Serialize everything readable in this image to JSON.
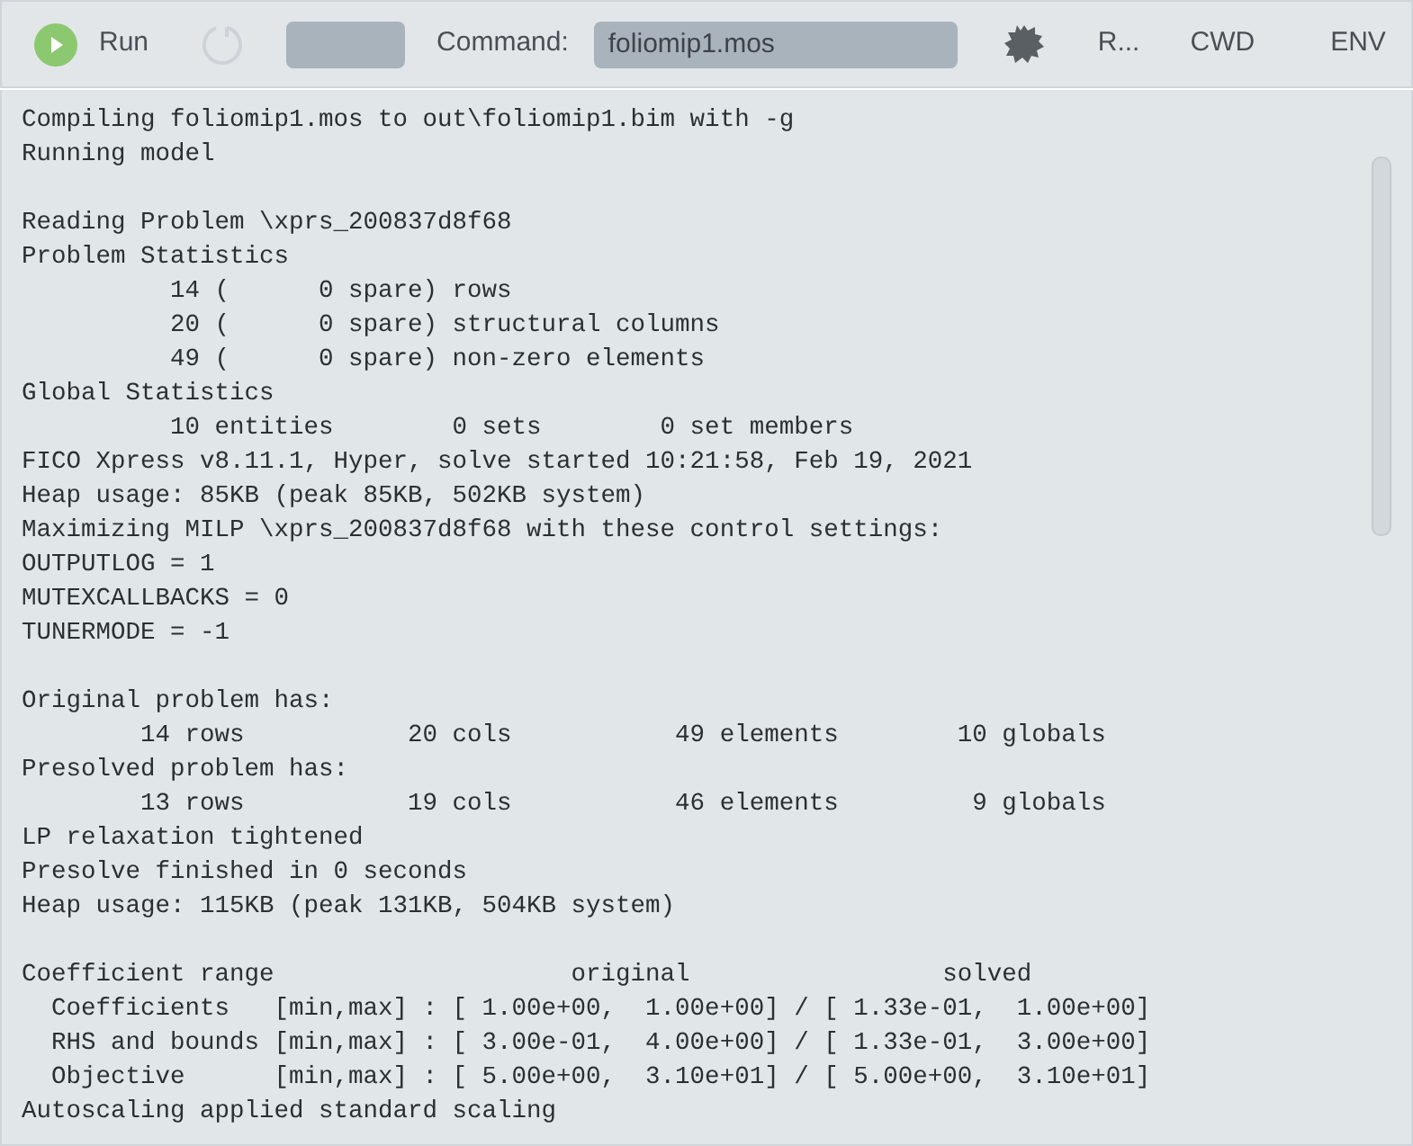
{
  "toolbar": {
    "run_label": "Run",
    "refresh": {
      "disabled": true
    },
    "command_label": "Command:",
    "command_value": "foliomip1.mos",
    "links": [
      "R...",
      "CWD",
      "ENV"
    ]
  },
  "output_lines": [
    {
      "kind": "text",
      "text": "Compiling foliomip1.mos to out\\foliomip1.bim with -g"
    },
    {
      "kind": "text",
      "text": "Running model"
    },
    {
      "kind": "blank"
    },
    {
      "kind": "text",
      "text": "Reading Problem \\xprs_200837d8f68"
    },
    {
      "kind": "text",
      "text": "Problem Statistics"
    },
    {
      "kind": "text",
      "text": "          14 (      0 spare) rows"
    },
    {
      "kind": "text",
      "text": "          20 (      0 spare) structural columns"
    },
    {
      "kind": "text",
      "text": "          49 (      0 spare) non-zero elements"
    },
    {
      "kind": "text",
      "text": "Global Statistics"
    },
    {
      "kind": "text",
      "text": "          10 entities        0 sets        0 set members"
    },
    {
      "kind": "text",
      "text": "FICO Xpress v8.11.1, Hyper, solve started 10:21:58, Feb 19, 2021"
    },
    {
      "kind": "text",
      "text": "Heap usage: 85KB (peak 85KB, 502KB system)"
    },
    {
      "kind": "text",
      "text": "Maximizing MILP \\xprs_200837d8f68 with these control settings:"
    },
    {
      "kind": "text",
      "text": "OUTPUTLOG = 1"
    },
    {
      "kind": "text",
      "text": "MUTEXCALLBACKS = 0"
    },
    {
      "kind": "text",
      "text": "TUNERMODE = -1"
    },
    {
      "kind": "blank"
    },
    {
      "kind": "text",
      "text": "Original problem has:"
    },
    {
      "kind": "text",
      "text": "        14 rows           20 cols           49 elements        10 globals"
    },
    {
      "kind": "text",
      "text": "Presolved problem has:"
    },
    {
      "kind": "text",
      "text": "        13 rows           19 cols           46 elements         9 globals"
    },
    {
      "kind": "text",
      "text": "LP relaxation tightened"
    },
    {
      "kind": "text",
      "text": "Presolve finished in 0 seconds"
    },
    {
      "kind": "text",
      "text": "Heap usage: 115KB (peak 131KB, 504KB system)"
    },
    {
      "kind": "blank"
    },
    {
      "kind": "text",
      "text": "Coefficient range                    original                 solved"
    },
    {
      "kind": "text",
      "text": "  Coefficients   [min,max] : [ 1.00e+00,  1.00e+00] / [ 1.33e-01,  1.00e+00]"
    },
    {
      "kind": "text",
      "text": "  RHS and bounds [min,max] : [ 3.00e-01,  4.00e+00] / [ 1.33e-01,  3.00e+00]"
    },
    {
      "kind": "text",
      "text": "  Objective      [min,max] : [ 5.00e+00,  3.10e+01] / [ 5.00e+00,  3.10e+01]"
    },
    {
      "kind": "text",
      "text": "Autoscaling applied standard scaling"
    }
  ]
}
